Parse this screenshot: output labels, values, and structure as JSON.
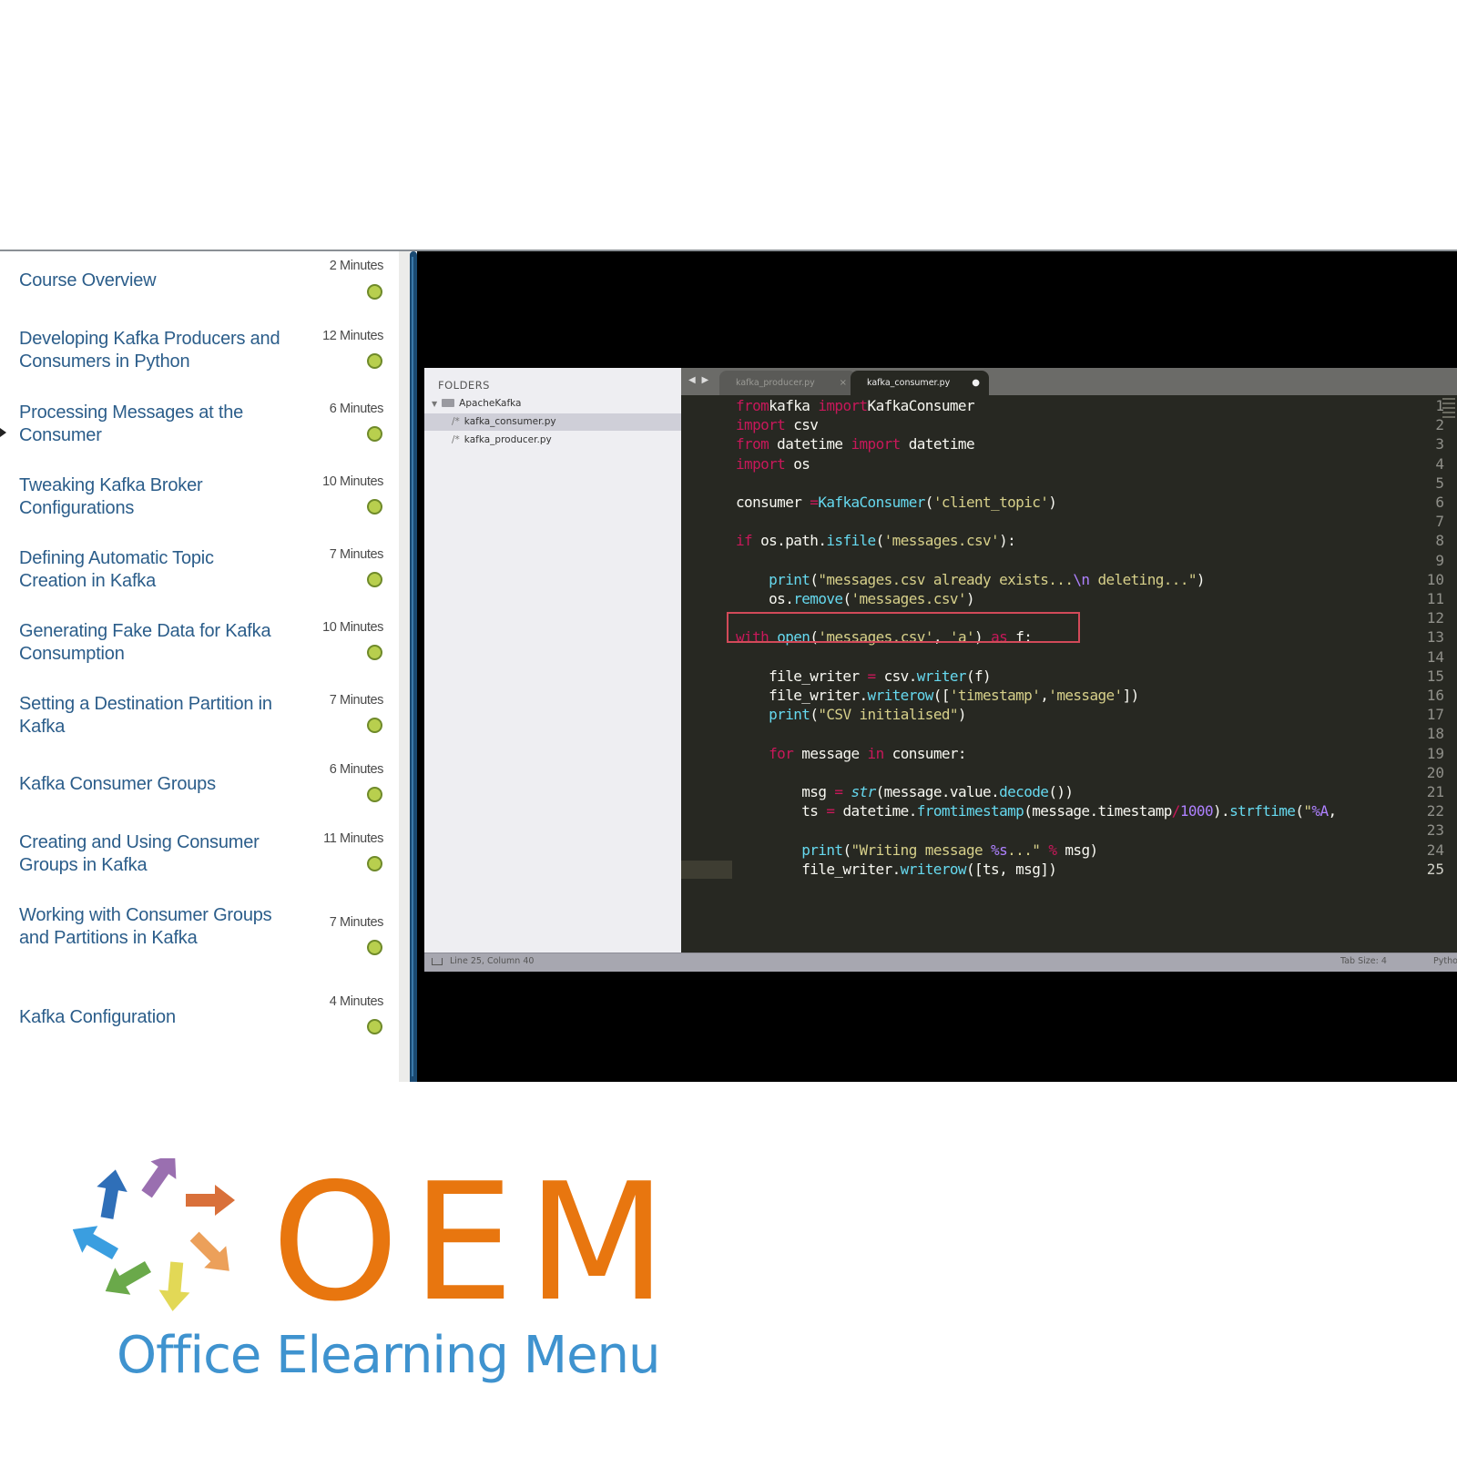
{
  "course": {
    "lessons": [
      {
        "title": "Course Overview",
        "duration": "2 Minutes",
        "status": "complete"
      },
      {
        "title": "Developing Kafka Producers and Consumers in Python",
        "duration": "12 Minutes",
        "status": "complete"
      },
      {
        "title": "Processing Messages at the Consumer",
        "duration": "6 Minutes",
        "status": "complete"
      },
      {
        "title": "Tweaking Kafka Broker Configurations",
        "duration": "10 Minutes",
        "status": "complete"
      },
      {
        "title": "Defining Automatic Topic Creation in Kafka",
        "duration": "7 Minutes",
        "status": "complete"
      },
      {
        "title": "Generating Fake Data for Kafka Consumption",
        "duration": "10 Minutes",
        "status": "complete"
      },
      {
        "title": "Setting a Destination Partition in Kafka",
        "duration": "7 Minutes",
        "status": "complete"
      },
      {
        "title": "Kafka Consumer Groups",
        "duration": "6 Minutes",
        "status": "complete"
      },
      {
        "title": "Creating and Using Consumer Groups in Kafka",
        "duration": "11 Minutes",
        "status": "complete"
      },
      {
        "title": "Working with Consumer Groups and Partitions in Kafka",
        "duration": "7 Minutes",
        "status": "complete"
      },
      {
        "title": "Kafka Configuration",
        "duration": "4 Minutes",
        "status": "complete"
      }
    ],
    "status_color": "#b8cf4e",
    "title_color": "#2b5d8a"
  },
  "editor": {
    "sidebar": {
      "heading": "FOLDERS",
      "folder": "ApacheKafka",
      "files": [
        "kafka_consumer.py",
        "kafka_producer.py"
      ],
      "selected_file": "kafka_consumer.py"
    },
    "tabs": [
      {
        "label": "kafka_producer.py",
        "close": "×",
        "active": false
      },
      {
        "label": "kafka_consumer.py",
        "close": "●",
        "active": true
      }
    ],
    "tab_nav": "◀ ▶",
    "active_line": 25,
    "highlighted_line": 13,
    "code": [
      [
        [
          "kw",
          "from"
        ],
        [
          "",
          "kafka "
        ],
        [
          "kw",
          "import"
        ],
        [
          "",
          "KafkaConsumer"
        ]
      ],
      [
        [
          "kw",
          "import"
        ],
        [
          "",
          " csv"
        ]
      ],
      [
        [
          "kw",
          "from"
        ],
        [
          "",
          " datetime "
        ],
        [
          "kw",
          "import"
        ],
        [
          "",
          " datetime"
        ]
      ],
      [
        [
          "kw",
          "import"
        ],
        [
          "",
          " os"
        ]
      ],
      [],
      [
        [
          "",
          "consumer "
        ],
        [
          "kw",
          "="
        ],
        [
          " fn",
          "KafkaConsumer"
        ],
        [
          "",
          "("
        ],
        [
          "str",
          "'client_topic'"
        ],
        [
          "",
          ")"
        ]
      ],
      [],
      [
        [
          "kw",
          "if"
        ],
        [
          "",
          " os.path."
        ],
        [
          "fn",
          "isfile"
        ],
        [
          "",
          "("
        ],
        [
          "str",
          "'messages.csv'"
        ],
        [
          "",
          "):"
        ]
      ],
      [],
      [
        [
          "",
          "    "
        ],
        [
          "fn",
          "print"
        ],
        [
          "",
          "("
        ],
        [
          "str",
          "\"messages.csv already exists..."
        ],
        [
          "num",
          "\\n"
        ],
        [
          "str",
          " deleting...\""
        ],
        [
          "",
          ")"
        ]
      ],
      [
        [
          "",
          "    os."
        ],
        [
          "fn",
          "remove"
        ],
        [
          "",
          "("
        ],
        [
          "str",
          "'messages.csv'"
        ],
        [
          "",
          ")"
        ]
      ],
      [],
      [
        [
          "kw",
          "with"
        ],
        [
          "",
          " "
        ],
        [
          "fn",
          "open"
        ],
        [
          "",
          "("
        ],
        [
          "str",
          "'messages.csv'"
        ],
        [
          "",
          ", "
        ],
        [
          "str",
          "'a'"
        ],
        [
          "",
          ") "
        ],
        [
          "kw",
          "as"
        ],
        [
          "",
          " f:"
        ]
      ],
      [],
      [
        [
          "",
          "    file_writer "
        ],
        [
          "kw",
          "="
        ],
        [
          "",
          " csv."
        ],
        [
          "fn",
          "writer"
        ],
        [
          "",
          "(f)"
        ]
      ],
      [
        [
          "",
          "    file_writer."
        ],
        [
          "fn",
          "writerow"
        ],
        [
          "",
          "(["
        ],
        [
          "str",
          "'timestamp'"
        ],
        [
          "",
          ","
        ],
        [
          "str",
          "'message'"
        ],
        [
          "",
          "])"
        ]
      ],
      [
        [
          "",
          "    "
        ],
        [
          "fn",
          "print"
        ],
        [
          "",
          "("
        ],
        [
          "str",
          "\"CSV initialised\""
        ],
        [
          "",
          ")"
        ]
      ],
      [],
      [
        [
          "",
          "    "
        ],
        [
          "kw",
          "for"
        ],
        [
          "",
          " message "
        ],
        [
          "kw",
          "in"
        ],
        [
          "",
          " consumer:"
        ]
      ],
      [],
      [
        [
          "",
          "        msg "
        ],
        [
          "kw",
          "="
        ],
        [
          "",
          " "
        ],
        [
          "it",
          "str"
        ],
        [
          "",
          "(message.value."
        ],
        [
          "fn",
          "decode"
        ],
        [
          "",
          "())"
        ]
      ],
      [
        [
          "",
          "        ts "
        ],
        [
          "kw",
          "="
        ],
        [
          "",
          " datetime."
        ],
        [
          "fn",
          "fromtimestamp"
        ],
        [
          "",
          "(message.timestamp"
        ],
        [
          "kw",
          "/"
        ],
        [
          "num",
          "1000"
        ],
        [
          "",
          ")."
        ],
        [
          "fn",
          "strftime"
        ],
        [
          "",
          "("
        ],
        [
          "str",
          "\""
        ],
        [
          "num",
          "%A"
        ],
        [
          "",
          ","
        ]
      ],
      [],
      [
        [
          "",
          "        "
        ],
        [
          "fn",
          "print"
        ],
        [
          "",
          "("
        ],
        [
          "str",
          "\"Writing message "
        ],
        [
          "num",
          "%s"
        ],
        [
          "str",
          "...\""
        ],
        [
          "",
          " "
        ],
        [
          "kw",
          "%"
        ],
        [
          "",
          " msg)"
        ]
      ],
      [
        [
          "",
          "        file_writer."
        ],
        [
          "fn",
          "writerow"
        ],
        [
          "",
          "([ts, msg])"
        ]
      ]
    ],
    "status": {
      "position": "Line 25, Column 40",
      "tab_size": "Tab Size: 4",
      "syntax": "Python"
    }
  },
  "brand": {
    "wordmark": "OEM",
    "tagline": "Office Elearning Menu",
    "wordmark_color": "#e8760f",
    "tagline_color": "#3f93cf",
    "arrow_colors": [
      "#2f6fb8",
      "#9a6fb0",
      "#d9703a",
      "#eca05a",
      "#e2d856",
      "#6aa94a",
      "#3a9ee0"
    ]
  }
}
